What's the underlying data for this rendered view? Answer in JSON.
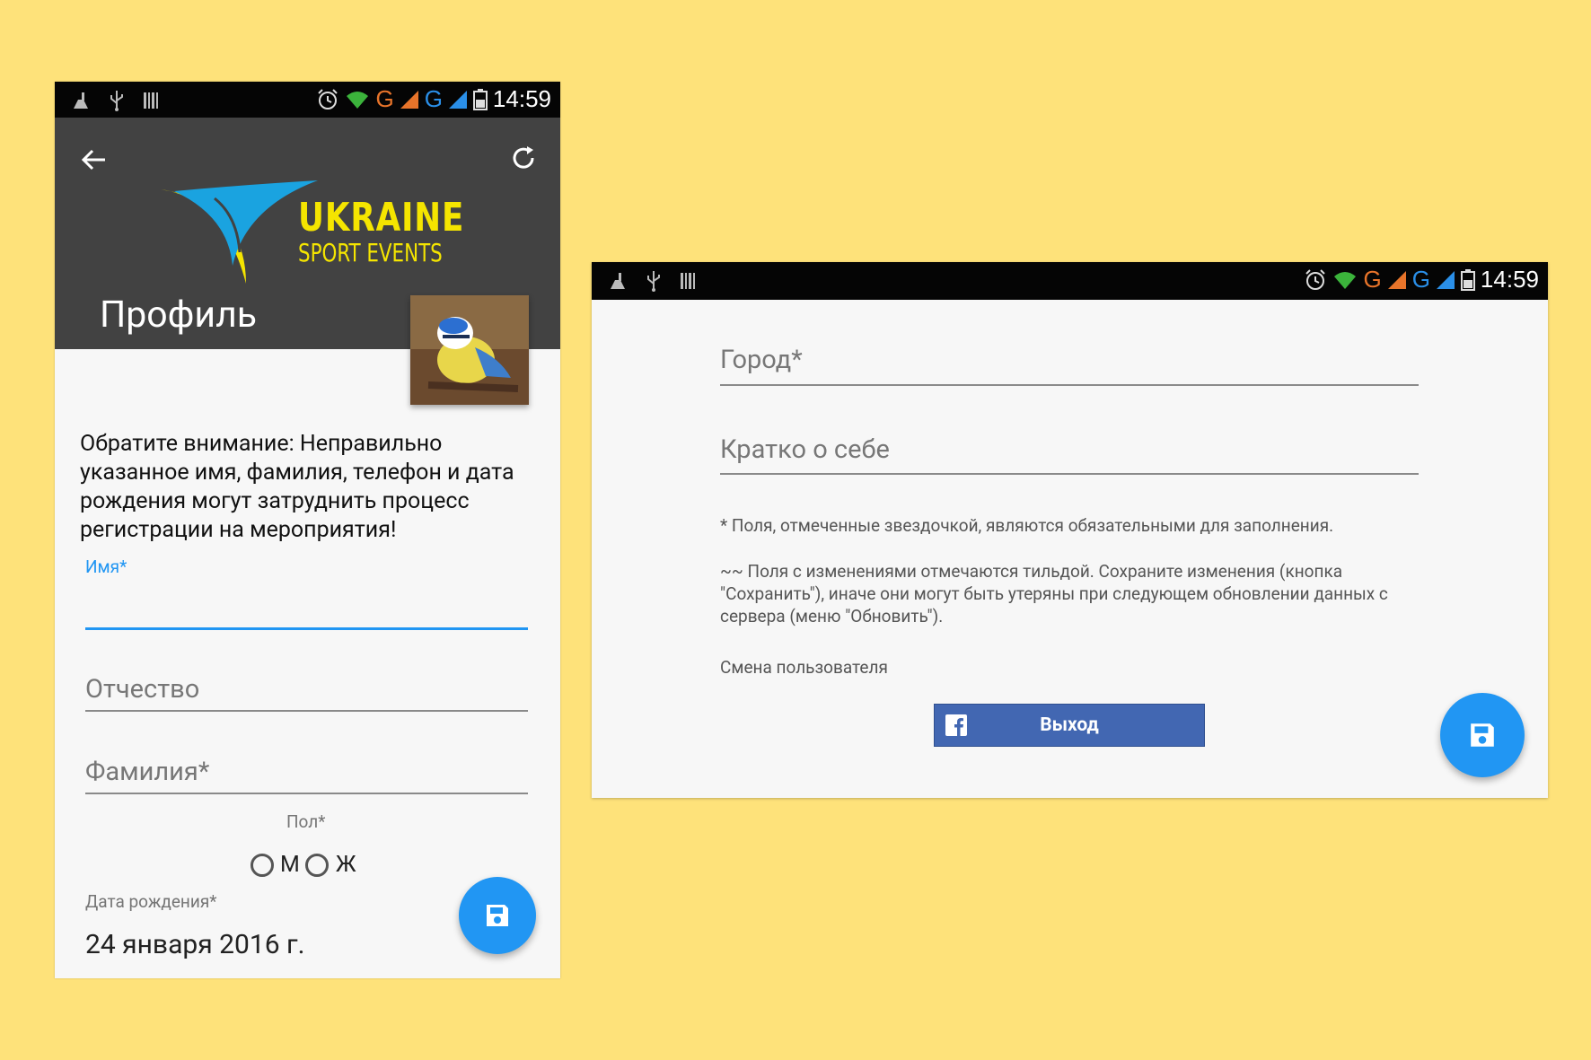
{
  "status_bar": {
    "time": "14:59",
    "network_1": "G",
    "network_2": "G"
  },
  "profile_screen": {
    "title": "Профиль",
    "logo": {
      "line1": "UKRAINE",
      "line2": "SPORT EVENTS"
    },
    "notice": "Обратите внимание: Неправильно указанное имя, фамилия, телефон и дата рождения могут затруднить процесс регистрации на мероприятия!",
    "fields": {
      "name_label": "Имя*",
      "patronymic_placeholder": "Отчество",
      "surname_placeholder": "Фамилия*"
    },
    "gender": {
      "label": "Пол*",
      "option_m": "М",
      "option_f": "Ж"
    },
    "dob": {
      "label": "Дата рождения*",
      "value": "24 января 2016 г."
    }
  },
  "profile_screen_2": {
    "city_placeholder": "Город*",
    "about_placeholder": "Кратко о себе",
    "hint_required": "* Поля, отмеченные звездочкой, являются обязательными для заполнения.",
    "hint_tilde": "~~ Поля с изменениями отмечаются тильдой. Сохраните изменения (кнопка \"Сохранить\"), иначе они могут быть утеряны при следующем обновлении данных с сервера (меню \"Обновить\").",
    "switch_user": "Смена пользователя",
    "logout_button": "Выход"
  },
  "colors": {
    "background": "#fee27a",
    "appbar": "#424242",
    "accent": "#2196f3",
    "facebook": "#4267b2",
    "logo_yellow": "#f5e500",
    "logo_blue": "#1aa3e0"
  }
}
